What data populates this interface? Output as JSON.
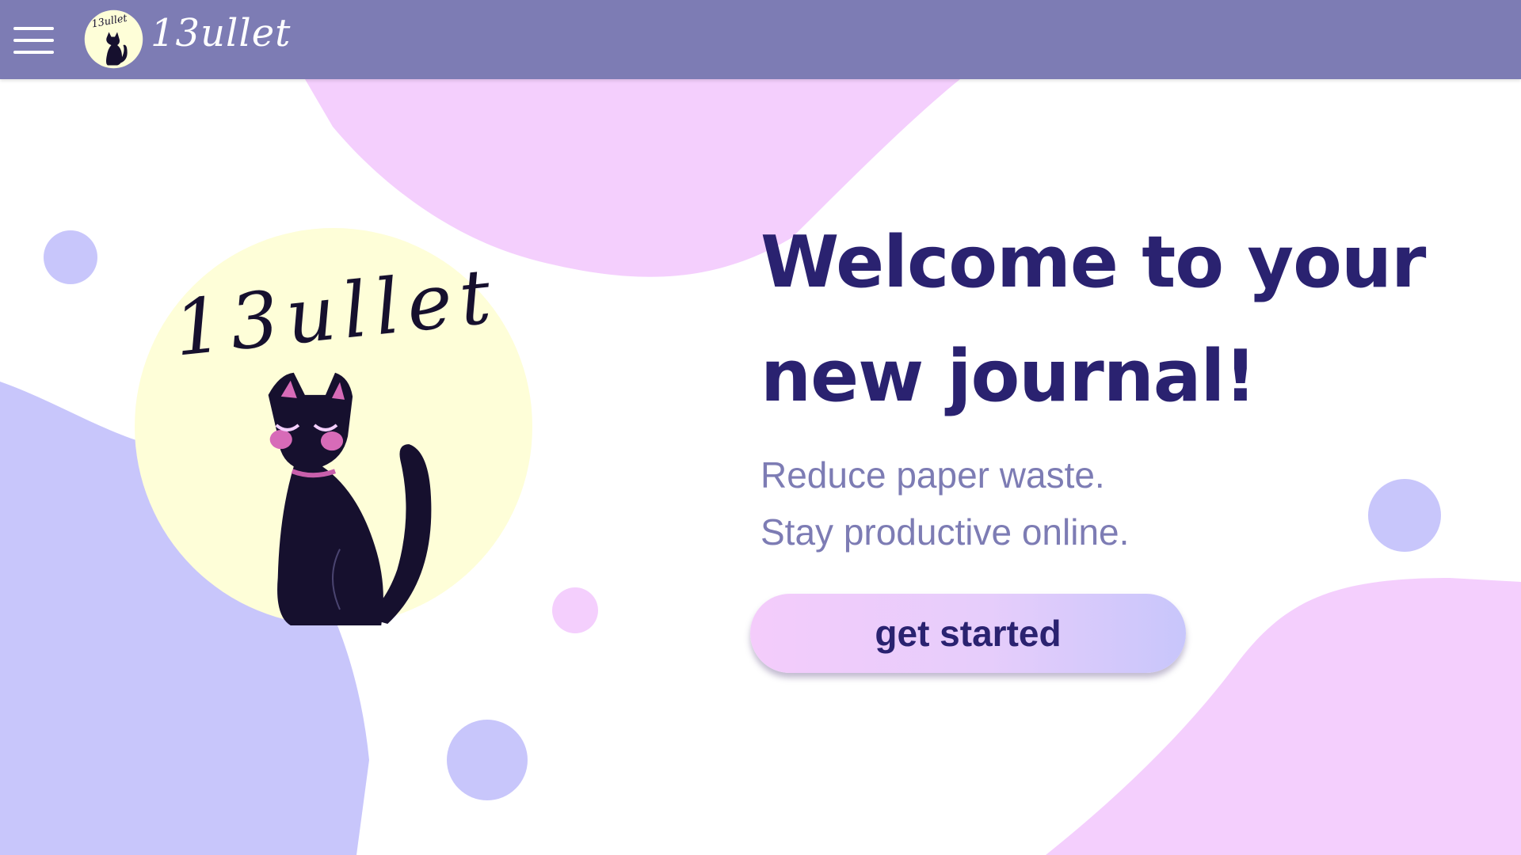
{
  "navbar": {
    "brand_name": "13ullet",
    "logo_text": "13ullet",
    "icons": [
      "menu-icon",
      "cat-logo"
    ]
  },
  "hero": {
    "logo_text": "13ullet",
    "headline_line1": "Welcome to your",
    "headline_line2": "new journal!",
    "tagline_line1": "Reduce paper waste.",
    "tagline_line2": "Stay productive online.",
    "cta_label": "get started"
  },
  "colors": {
    "navbar": "#7d7cb4",
    "headline": "#2a2270",
    "tagline": "#7d7cb4",
    "blob_pink": "#f4cffd",
    "blob_lavender": "#c8c6fb",
    "logo_background": "#fefed8",
    "cat": "#16102e"
  }
}
